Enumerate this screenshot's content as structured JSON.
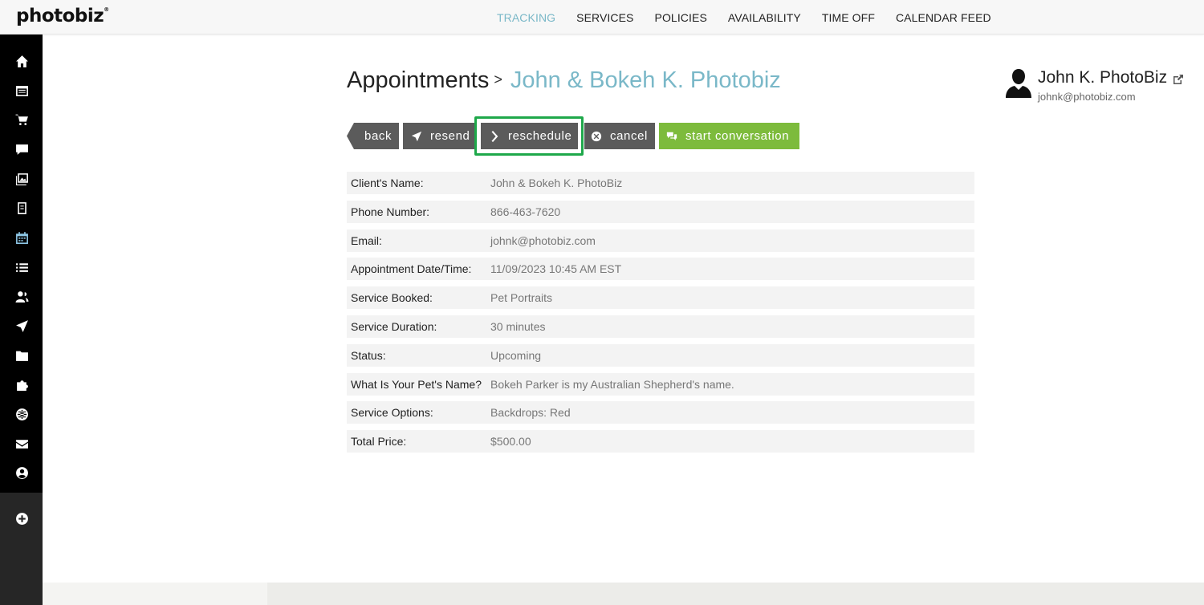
{
  "brand": {
    "logo_text": "photobiz",
    "logo_mark": "®"
  },
  "topnav": {
    "items": [
      {
        "label": "TRACKING",
        "active": true
      },
      {
        "label": "SERVICES"
      },
      {
        "label": "POLICIES"
      },
      {
        "label": "AVAILABILITY"
      },
      {
        "label": "TIME OFF"
      },
      {
        "label": "CALENDAR FEED"
      }
    ]
  },
  "sidebar": {
    "icons": [
      "home-icon",
      "calendar-list-icon",
      "cart-icon",
      "chat-icon",
      "gallery-icon",
      "document-icon",
      "scheduler-icon",
      "list-icon",
      "contacts-icon",
      "send-icon",
      "folder-icon",
      "puzzle-icon",
      "globe-icon",
      "mail-icon",
      "account-icon",
      "add-icon"
    ],
    "active": "scheduler-icon"
  },
  "breadcrumb": {
    "root": "Appointments",
    "separator": ">",
    "current": "John & Bokeh K. Photobiz"
  },
  "user": {
    "name": "John K. PhotoBiz",
    "email": "johnk@photobiz.com"
  },
  "actions": {
    "back": "back",
    "resend": "resend",
    "reschedule": "reschedule",
    "cancel": "cancel",
    "conversation": "start conversation",
    "colors": {
      "dark": "#5b5b5b",
      "green": "#7dbb3c",
      "highlight": "#1ea84a"
    }
  },
  "details": [
    {
      "label": "Client's Name:",
      "value": "John & Bokeh K. PhotoBiz"
    },
    {
      "label": "Phone Number:",
      "value": "866-463-7620"
    },
    {
      "label": "Email:",
      "value": "johnk@photobiz.com"
    },
    {
      "label": "Appointment Date/Time:",
      "value": "11/09/2023 10:45 AM EST"
    },
    {
      "label": "Service Booked:",
      "value": "Pet Portraits"
    },
    {
      "label": "Service Duration:",
      "value": "30 minutes"
    },
    {
      "label": "Status:",
      "value": "Upcoming"
    },
    {
      "label": "What Is Your Pet's Name?",
      "value": "Bokeh Parker is my Australian Shepherd's name."
    },
    {
      "label": "Service Options:",
      "value": "Backdrops: Red"
    },
    {
      "label": "Total Price:",
      "value": "$500.00"
    }
  ],
  "colors": {
    "accent": "#7ab8c8",
    "sidebar": "#000000"
  }
}
